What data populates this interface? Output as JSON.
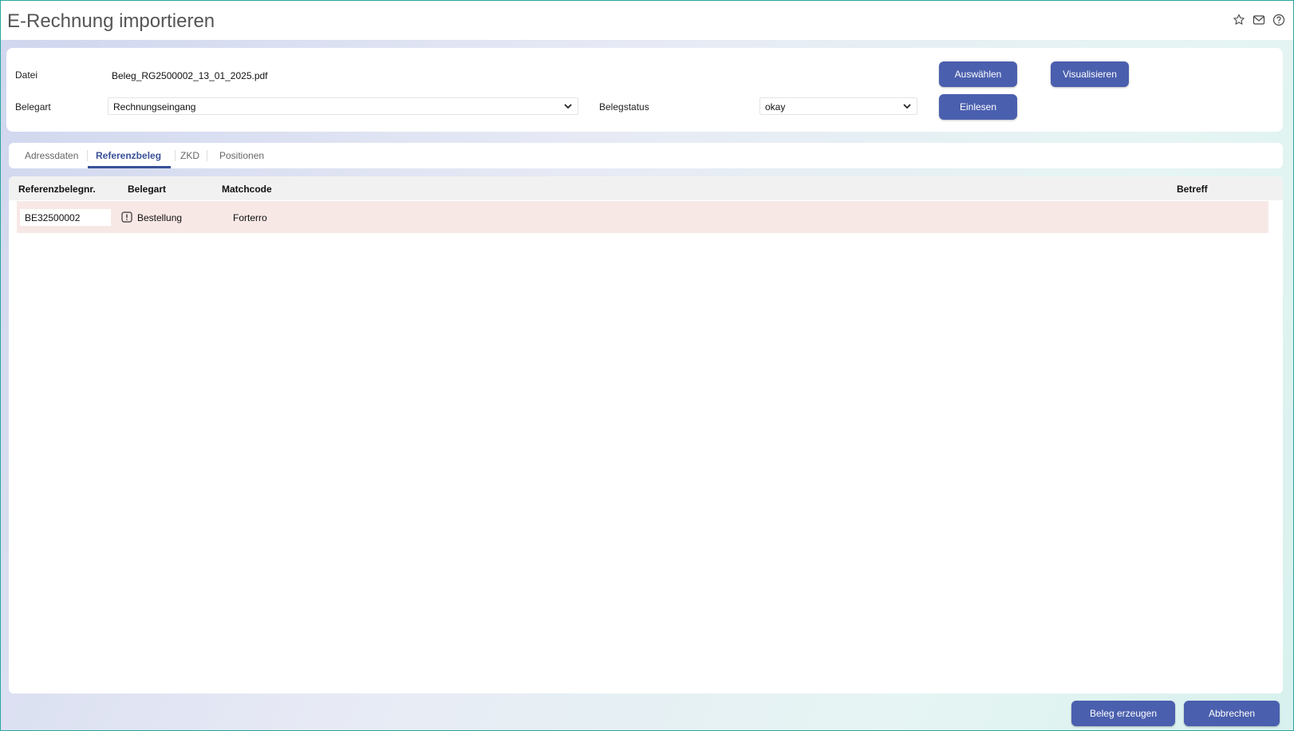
{
  "window": {
    "title": "E-Rechnung importieren"
  },
  "header_icons": [
    "star-icon",
    "mail-icon",
    "help-icon"
  ],
  "form": {
    "datei_label": "Datei",
    "datei_value": "Beleg_RG2500002_13_01_2025.pdf",
    "belegart_label": "Belegart",
    "belegart_value": "Rechnungseingang",
    "belegstatus_label": "Belegstatus",
    "belegstatus_value": "okay",
    "btn_auswaehlen": "Auswählen",
    "btn_visualisieren": "Visualisieren",
    "btn_einlesen": "Einlesen"
  },
  "tabs": [
    {
      "label": "Adressdaten",
      "active": false
    },
    {
      "label": "Referenzbeleg",
      "active": true
    },
    {
      "label": "ZKD",
      "active": false
    },
    {
      "label": "Positionen",
      "active": false
    }
  ],
  "grid": {
    "columns": [
      "Referenzbelegnr.",
      "Belegart",
      "Matchcode",
      "Betreff"
    ],
    "rows": [
      {
        "referenzbelegnr": "BE32500002",
        "belegart": "Bestellung",
        "matchcode": "Forterro",
        "betreff": "",
        "warning": true
      }
    ]
  },
  "footer": {
    "btn_beleg_erzeugen": "Beleg erzeugen",
    "btn_abbrechen": "Abbrechen"
  },
  "colors": {
    "accent": "#4a5fae",
    "tab_active": "#3a5198",
    "row_highlight": "#f7e8e6",
    "window_border": "#2aa7a0"
  }
}
